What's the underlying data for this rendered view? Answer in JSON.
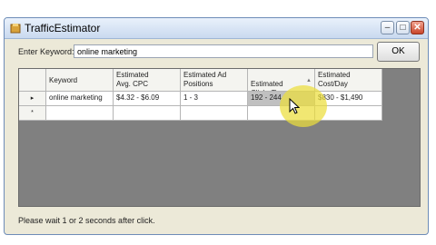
{
  "window": {
    "title": "TrafficEstimator"
  },
  "titlebar_buttons": {
    "minimize": "–",
    "maximize": "□",
    "close": "✕"
  },
  "search": {
    "label": "Enter Keyword:",
    "value": "online marketing"
  },
  "ok_button": {
    "label": "OK"
  },
  "grid": {
    "columns": [
      "Keyword",
      "Estimated\nAvg. CPC",
      "Estimated Ad\nPositions",
      "Estimated\nClicks/Day",
      "Estimated\nCost/Day"
    ],
    "rows": [
      [
        "online marketing",
        "$4.32 - $6.09",
        "1 - 3",
        "192 - 244",
        "$830 - $1,490"
      ]
    ],
    "row_markers": [
      "▸",
      "*"
    ]
  },
  "status": {
    "text": "Please wait 1 or 2 seconds  after click."
  },
  "colors": {
    "highlight": "#ecde3c",
    "selected_cell": "#c0c0c0",
    "grid_bg": "#808080"
  }
}
